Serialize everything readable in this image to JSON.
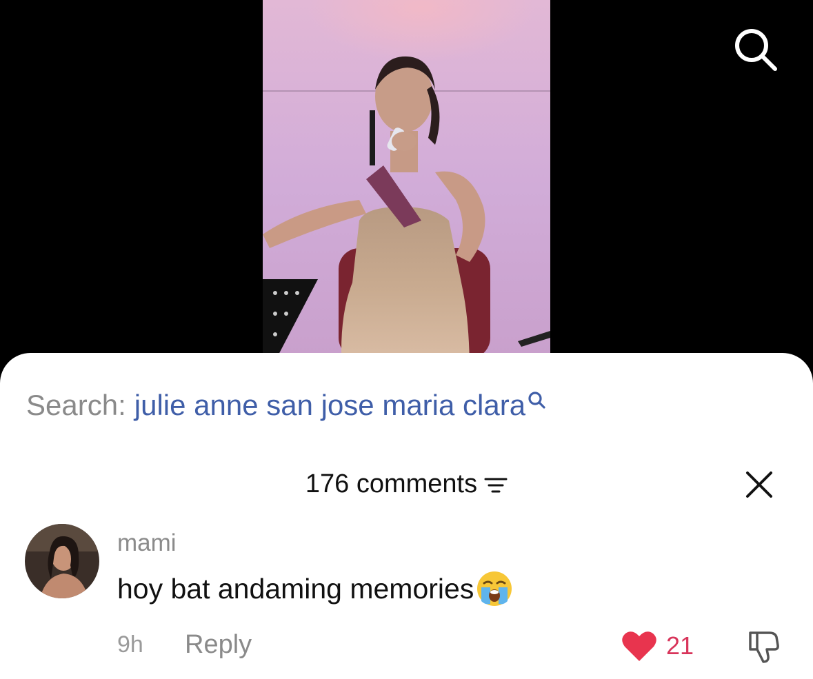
{
  "video": {
    "description_icon": "video-thumbnail"
  },
  "top_bar": {
    "search_icon": "search-icon"
  },
  "search_suggestion": {
    "prefix": "Search:",
    "query": "julie anne san jose maria clara",
    "icon": "search-icon"
  },
  "comments_header": {
    "count_label": "176 comments",
    "sort_icon": "sort-icon",
    "close_icon": "close-icon"
  },
  "comment": {
    "username": "mami",
    "text": "hoy bat andaming memories",
    "emoji": "loudly-crying-face-emoji",
    "timestamp": "9h",
    "reply_label": "Reply",
    "like_count": "21",
    "like_icon": "heart-icon",
    "dislike_icon": "thumbs-down-icon"
  },
  "colors": {
    "accent_blue": "#3f5ea8",
    "like_red": "#e8344e",
    "muted_gray": "#8a8a8a"
  }
}
